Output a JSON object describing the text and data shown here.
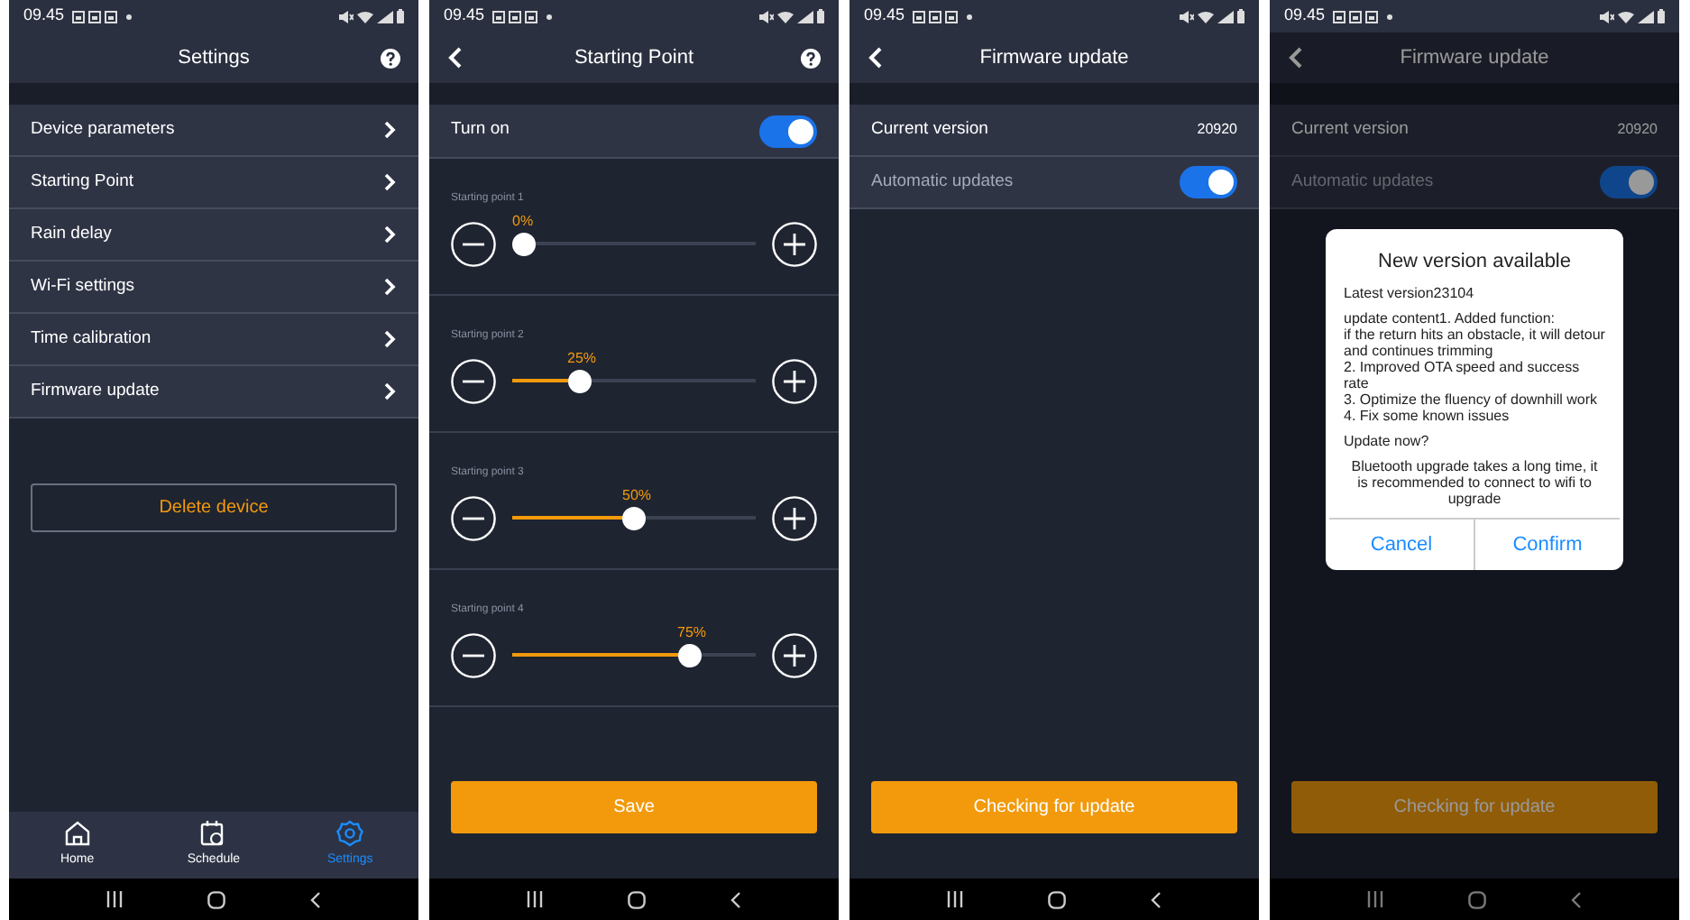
{
  "screens": [
    {
      "kind": "settings",
      "time": "09.45",
      "title": "Settings",
      "back": false,
      "help": true,
      "dimmed": false,
      "items": [
        {
          "label": "Device parameters"
        },
        {
          "label": "Starting Point"
        },
        {
          "label": "Rain delay"
        },
        {
          "label": "Wi-Fi settings"
        },
        {
          "label": "Time calibration"
        },
        {
          "label": "Firmware update"
        }
      ],
      "delete_button": "Delete device",
      "bottom_nav": [
        {
          "kind": "home",
          "label": "Home",
          "selected": false
        },
        {
          "kind": "schedule",
          "label": "Schedule",
          "selected": false
        },
        {
          "kind": "settings",
          "label": "Settings",
          "selected": true
        }
      ]
    },
    {
      "kind": "starting_point",
      "time": "09.45",
      "title": "Starting Point",
      "back": true,
      "help": true,
      "dimmed": false,
      "toggle": {
        "label": "Turn on",
        "on": true
      },
      "sliders": [
        {
          "label": "Starting point 1",
          "reading": "0%",
          "level": 0
        },
        {
          "label": "Starting point 2",
          "reading": "25%",
          "level": 0.25
        },
        {
          "label": "Starting point 3",
          "reading": "50%",
          "level": 0.5
        },
        {
          "label": "Starting point 4",
          "reading": "75%",
          "level": 0.75
        }
      ],
      "button": "Save"
    },
    {
      "kind": "firmware",
      "time": "09.45",
      "title": "Firmware update",
      "back": true,
      "help": false,
      "dimmed": false,
      "rows": [
        {
          "kind": "value",
          "label": "Current version",
          "value": "20920",
          "disabled": false
        },
        {
          "kind": "toggle",
          "label": "Automatic updates",
          "on": true,
          "disabled": true
        }
      ],
      "button": "Checking for update"
    },
    {
      "kind": "firmware",
      "time": "09.45",
      "title": "Firmware update",
      "back": true,
      "help": false,
      "dimmed": true,
      "rows": [
        {
          "kind": "value",
          "label": "Current version",
          "value": "20920",
          "disabled": false
        },
        {
          "kind": "toggle",
          "label": "Automatic updates",
          "on": true,
          "disabled": true
        }
      ],
      "button": "Checking for update",
      "dialog": {
        "title": "New version available",
        "paragraphs": [
          "Latest version23104",
          "update content1. Added function:\nif the return hits an obstacle, it will detour and continues trimming\n2. Improved OTA speed and success rate\n3. Optimize the fluency of downhill work\n4. Fix some known issues",
          "Update now?"
        ],
        "note": "Bluetooth upgrade takes a long time, it is recommended to connect to wifi to upgrade",
        "buttons": [
          "Cancel",
          "Confirm"
        ]
      }
    }
  ]
}
